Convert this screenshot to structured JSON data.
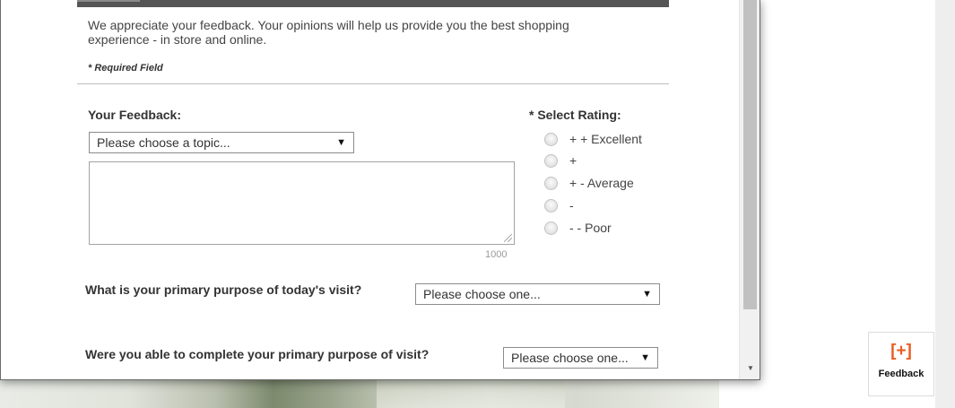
{
  "intro": {
    "line1": "We appreciate your feedback. Your opinions will help us provide you the best shopping",
    "line2": "experience - in store and online."
  },
  "required_note": "* Required Field",
  "feedback": {
    "label": "Your Feedback:",
    "topic_select": "Please choose a topic...",
    "char_count": "1000"
  },
  "rating": {
    "title": "* Select Rating:",
    "options": [
      "+ + Excellent",
      "+",
      "+ - Average",
      "-",
      "- - Poor"
    ]
  },
  "questions": {
    "purpose_label": "What is your primary purpose of today's visit?",
    "purpose_select": "Please choose one...",
    "complete_label": "Were you able to complete your primary purpose of visit?",
    "complete_select": "Please choose one..."
  },
  "select_arrow": "▼",
  "scroll_arrow": "▼",
  "feedback_widget": {
    "icon": "[+]",
    "label": "Feedback"
  },
  "colors": {
    "accent": "#e85d21",
    "topbar": "#555555"
  }
}
